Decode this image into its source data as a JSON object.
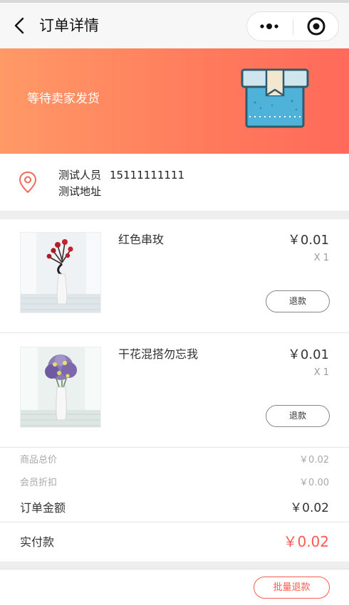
{
  "navbar": {
    "title": "订单详情",
    "back_icon": "chevron-left-icon",
    "more_icon": "more-dots-icon",
    "close_icon": "target-circle-icon"
  },
  "banner": {
    "status_text": "等待卖家发货",
    "illustration_icon": "package-box-icon",
    "gradient_start": "#ff9966",
    "gradient_end": "#ff6a5a"
  },
  "address": {
    "icon": "location-pin-icon",
    "name": "测试人员",
    "phone": "15111111111",
    "detail": "测试地址"
  },
  "products": [
    {
      "name": "红色串玫",
      "price": "￥0.01",
      "qty": "X 1",
      "refund_label": "退款"
    },
    {
      "name": "干花混搭勿忘我",
      "price": "￥0.01",
      "qty": "X 1",
      "refund_label": "退款"
    }
  ],
  "summary": {
    "goods_total_label": "商品总价",
    "goods_total_value": "￥0.02",
    "member_discount_label": "会员折扣",
    "member_discount_value": "￥0.00",
    "order_amount_label": "订单金额",
    "order_amount_value": "￥0.02"
  },
  "paid": {
    "label": "实付款",
    "value": "￥0.02"
  },
  "footer": {
    "batch_refund_label": "批量退款"
  },
  "colors": {
    "accent": "#ff5a52",
    "muted": "#a8a8a8"
  }
}
